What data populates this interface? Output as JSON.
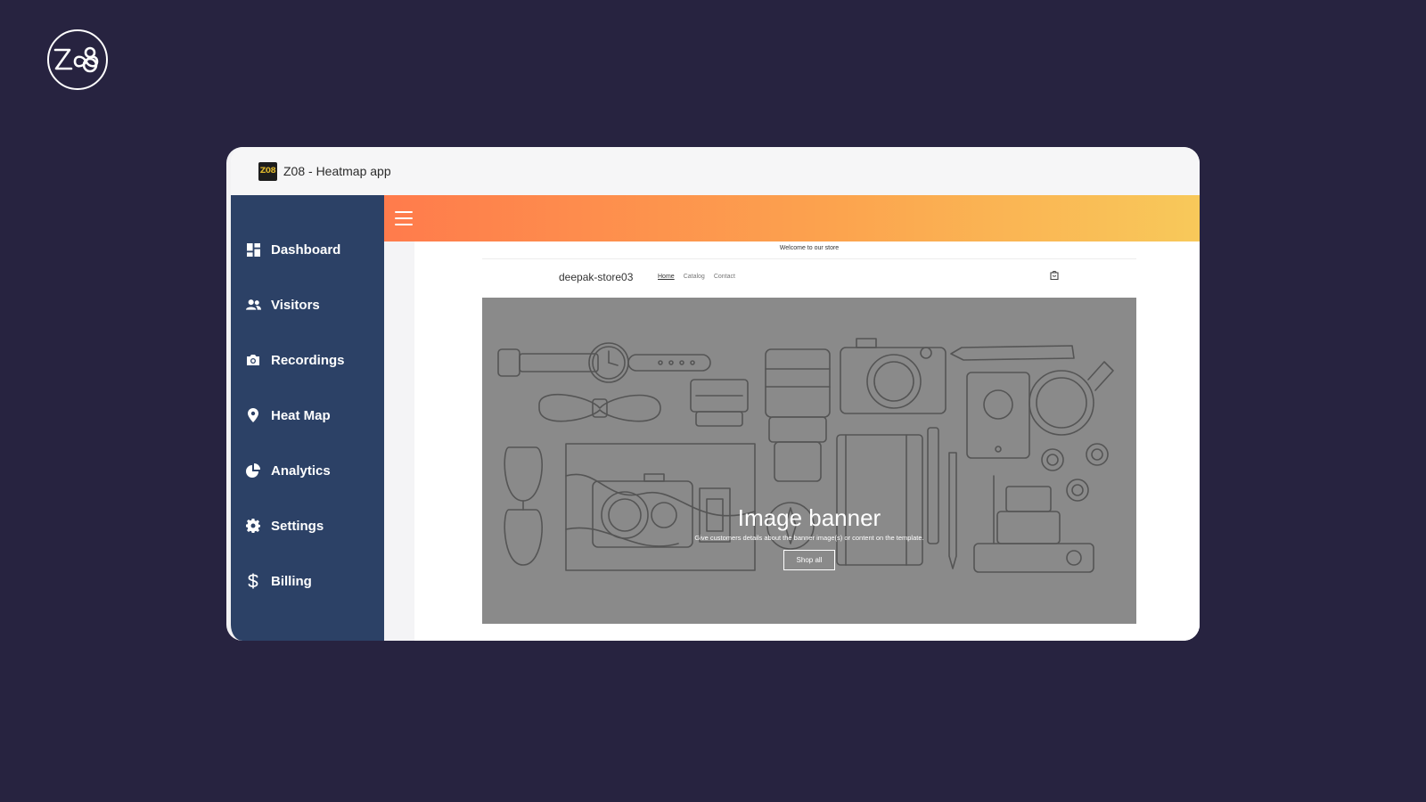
{
  "window": {
    "title": "Z08 - Heatmap app",
    "app_icon_text": "Z08"
  },
  "sidebar": {
    "items": [
      {
        "label": "Dashboard",
        "icon": "dashboard-icon"
      },
      {
        "label": "Visitors",
        "icon": "users-icon"
      },
      {
        "label": "Recordings",
        "icon": "camera-icon"
      },
      {
        "label": "Heat Map",
        "icon": "map-pin-icon"
      },
      {
        "label": "Analytics",
        "icon": "pie-chart-icon"
      },
      {
        "label": "Settings",
        "icon": "gear-icon"
      },
      {
        "label": "Billing",
        "icon": "dollar-icon"
      }
    ]
  },
  "store": {
    "announcement": "Welcome to our store",
    "name": "deepak-store03",
    "nav": [
      "Home",
      "Catalog",
      "Contact"
    ],
    "active_nav": "Home"
  },
  "banner": {
    "heading": "Image banner",
    "subtext": "Give customers details about the banner image(s) or content on the template.",
    "button_label": "Shop all"
  },
  "colors": {
    "background": "#272340",
    "sidebar": "#2c4166",
    "topbar_gradient_start": "#ff7b4c",
    "topbar_gradient_end": "#f8c95a",
    "banner": "#8a8a8a"
  }
}
